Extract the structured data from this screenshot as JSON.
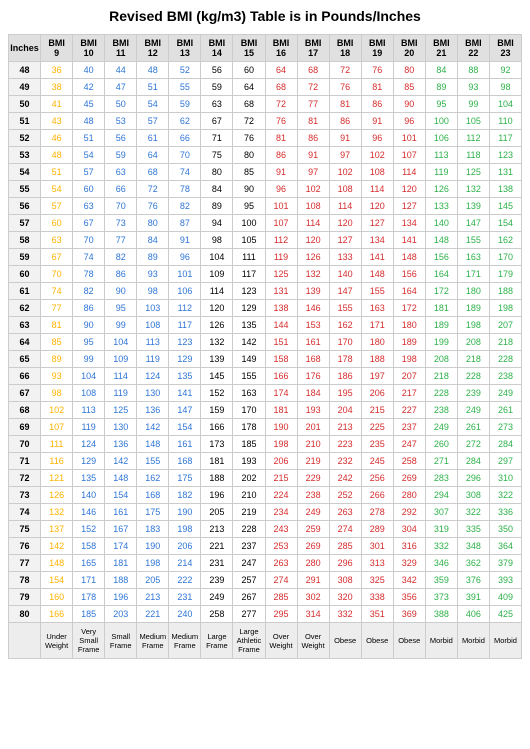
{
  "title": "Revised BMI (kg/m3) Table is in Pounds/Inches",
  "chart_data": {
    "type": "table",
    "row_header": "Inches",
    "col_prefix": "BMI",
    "bmi_values": [
      9,
      10,
      11,
      12,
      13,
      14,
      15,
      16,
      17,
      18,
      19,
      20,
      21,
      22,
      23
    ],
    "rows": [
      {
        "in": 48,
        "v": [
          36,
          40,
          44,
          48,
          52,
          56,
          60,
          64,
          68,
          72,
          76,
          80,
          84,
          88,
          92
        ]
      },
      {
        "in": 49,
        "v": [
          38,
          42,
          47,
          51,
          55,
          59,
          64,
          68,
          72,
          76,
          81,
          85,
          89,
          93,
          98
        ]
      },
      {
        "in": 50,
        "v": [
          41,
          45,
          50,
          54,
          59,
          63,
          68,
          72,
          77,
          81,
          86,
          90,
          95,
          99,
          104
        ]
      },
      {
        "in": 51,
        "v": [
          43,
          48,
          53,
          57,
          62,
          67,
          72,
          76,
          81,
          86,
          91,
          96,
          100,
          105,
          110
        ]
      },
      {
        "in": 52,
        "v": [
          46,
          51,
          56,
          61,
          66,
          71,
          76,
          81,
          86,
          91,
          96,
          101,
          106,
          112,
          117
        ]
      },
      {
        "in": 53,
        "v": [
          48,
          54,
          59,
          64,
          70,
          75,
          80,
          86,
          91,
          97,
          102,
          107,
          113,
          118,
          123
        ]
      },
      {
        "in": 54,
        "v": [
          51,
          57,
          63,
          68,
          74,
          80,
          85,
          91,
          97,
          102,
          108,
          114,
          119,
          125,
          131
        ]
      },
      {
        "in": 55,
        "v": [
          54,
          60,
          66,
          72,
          78,
          84,
          90,
          96,
          102,
          108,
          114,
          120,
          126,
          132,
          138
        ]
      },
      {
        "in": 56,
        "v": [
          57,
          63,
          70,
          76,
          82,
          89,
          95,
          101,
          108,
          114,
          120,
          127,
          133,
          139,
          145
        ]
      },
      {
        "in": 57,
        "v": [
          60,
          67,
          73,
          80,
          87,
          94,
          100,
          107,
          114,
          120,
          127,
          134,
          140,
          147,
          154
        ]
      },
      {
        "in": 58,
        "v": [
          63,
          70,
          77,
          84,
          91,
          98,
          105,
          112,
          120,
          127,
          134,
          141,
          148,
          155,
          162
        ]
      },
      {
        "in": 59,
        "v": [
          67,
          74,
          82,
          89,
          96,
          104,
          111,
          119,
          126,
          133,
          141,
          148,
          156,
          163,
          170
        ]
      },
      {
        "in": 60,
        "v": [
          70,
          78,
          86,
          93,
          101,
          109,
          117,
          125,
          132,
          140,
          148,
          156,
          164,
          171,
          179
        ]
      },
      {
        "in": 61,
        "v": [
          74,
          82,
          90,
          98,
          106,
          114,
          123,
          131,
          139,
          147,
          155,
          164,
          172,
          180,
          188
        ]
      },
      {
        "in": 62,
        "v": [
          77,
          86,
          95,
          103,
          112,
          120,
          129,
          138,
          146,
          155,
          163,
          172,
          181,
          189,
          198
        ]
      },
      {
        "in": 63,
        "v": [
          81,
          90,
          99,
          108,
          117,
          126,
          135,
          144,
          153,
          162,
          171,
          180,
          189,
          198,
          207
        ]
      },
      {
        "in": 64,
        "v": [
          85,
          95,
          104,
          113,
          123,
          132,
          142,
          151,
          161,
          170,
          180,
          189,
          199,
          208,
          218
        ]
      },
      {
        "in": 65,
        "v": [
          89,
          99,
          109,
          119,
          129,
          139,
          149,
          158,
          168,
          178,
          188,
          198,
          208,
          218,
          228
        ]
      },
      {
        "in": 66,
        "v": [
          93,
          104,
          114,
          124,
          135,
          145,
          155,
          166,
          176,
          186,
          197,
          207,
          218,
          228,
          238
        ]
      },
      {
        "in": 67,
        "v": [
          98,
          108,
          119,
          130,
          141,
          152,
          163,
          174,
          184,
          195,
          206,
          217,
          228,
          239,
          249
        ]
      },
      {
        "in": 68,
        "v": [
          102,
          113,
          125,
          136,
          147,
          159,
          170,
          181,
          193,
          204,
          215,
          227,
          238,
          249,
          261
        ]
      },
      {
        "in": 69,
        "v": [
          107,
          119,
          130,
          142,
          154,
          166,
          178,
          190,
          201,
          213,
          225,
          237,
          249,
          261,
          273
        ]
      },
      {
        "in": 70,
        "v": [
          111,
          124,
          136,
          148,
          161,
          173,
          185,
          198,
          210,
          223,
          235,
          247,
          260,
          272,
          284
        ]
      },
      {
        "in": 71,
        "v": [
          116,
          129,
          142,
          155,
          168,
          181,
          193,
          206,
          219,
          232,
          245,
          258,
          271,
          284,
          297
        ]
      },
      {
        "in": 72,
        "v": [
          121,
          135,
          148,
          162,
          175,
          188,
          202,
          215,
          229,
          242,
          256,
          269,
          283,
          296,
          310
        ]
      },
      {
        "in": 73,
        "v": [
          126,
          140,
          154,
          168,
          182,
          196,
          210,
          224,
          238,
          252,
          266,
          280,
          294,
          308,
          322
        ]
      },
      {
        "in": 74,
        "v": [
          132,
          146,
          161,
          175,
          190,
          205,
          219,
          234,
          249,
          263,
          278,
          292,
          307,
          322,
          336
        ]
      },
      {
        "in": 75,
        "v": [
          137,
          152,
          167,
          183,
          198,
          213,
          228,
          243,
          259,
          274,
          289,
          304,
          319,
          335,
          350
        ]
      },
      {
        "in": 76,
        "v": [
          142,
          158,
          174,
          190,
          206,
          221,
          237,
          253,
          269,
          285,
          301,
          316,
          332,
          348,
          364
        ]
      },
      {
        "in": 77,
        "v": [
          148,
          165,
          181,
          198,
          214,
          231,
          247,
          263,
          280,
          296,
          313,
          329,
          346,
          362,
          379
        ]
      },
      {
        "in": 78,
        "v": [
          154,
          171,
          188,
          205,
          222,
          239,
          257,
          274,
          291,
          308,
          325,
          342,
          359,
          376,
          393
        ]
      },
      {
        "in": 79,
        "v": [
          160,
          178,
          196,
          213,
          231,
          249,
          267,
          285,
          302,
          320,
          338,
          356,
          373,
          391,
          409
        ]
      },
      {
        "in": 80,
        "v": [
          166,
          185,
          203,
          221,
          240,
          258,
          277,
          295,
          314,
          332,
          351,
          369,
          388,
          406,
          425
        ]
      }
    ],
    "footer": [
      "",
      "Under Weight",
      "Very Small Frame",
      "Small Frame",
      "Medium Frame",
      "Medium Frame",
      "Large Frame",
      "Large Athletic Frame",
      "Over Weight",
      "Over Weight",
      "Obese",
      "Obese",
      "Obese",
      "Morbid",
      "Morbid",
      "Morbid"
    ],
    "colors": {
      "c9": "#ffb300",
      "c10": "#2e75d6",
      "c11": "#2e75d6",
      "c12": "#2e75d6",
      "c13": "#2e75d6",
      "c14": "#000000",
      "c15": "#000000",
      "c16": "#d62c2c",
      "c17": "#d62c2c",
      "c18": "#d62c2c",
      "c19": "#d62c2c",
      "c20": "#d62c2c",
      "c21": "#2db24a",
      "c22": "#2db24a",
      "c23": "#2db24a"
    }
  }
}
